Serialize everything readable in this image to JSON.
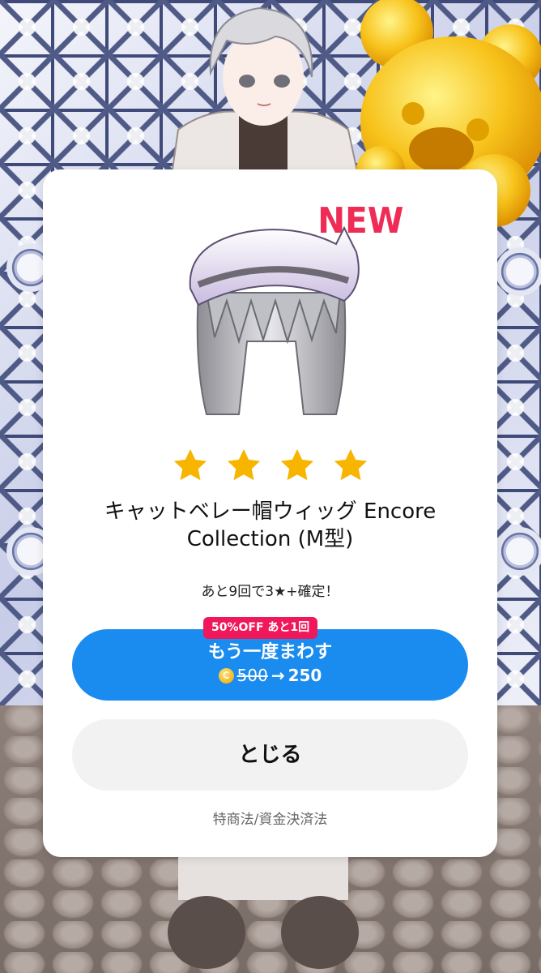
{
  "dialog": {
    "new_badge": "NEW",
    "rarity_stars": 4,
    "item_name": "キャットベレー帽ウィッグ Encore Collection (M型)",
    "pity_text": "あと9回で3★+確定！",
    "discount_tag": "50%OFF あと1回",
    "retry_label": "もう一度まわす",
    "coin_symbol": "C",
    "old_price": "500",
    "arrow": "→",
    "new_price": "250",
    "close_label": "とじる",
    "legal_link": "特商法/資金決済法"
  },
  "colors": {
    "accent_blue": "#1a8cf0",
    "discount_pink": "#f0185a",
    "new_badge": "#ef2c55",
    "star_gold": "#f7b500"
  },
  "icons": [
    "star-icon",
    "coin-icon"
  ]
}
